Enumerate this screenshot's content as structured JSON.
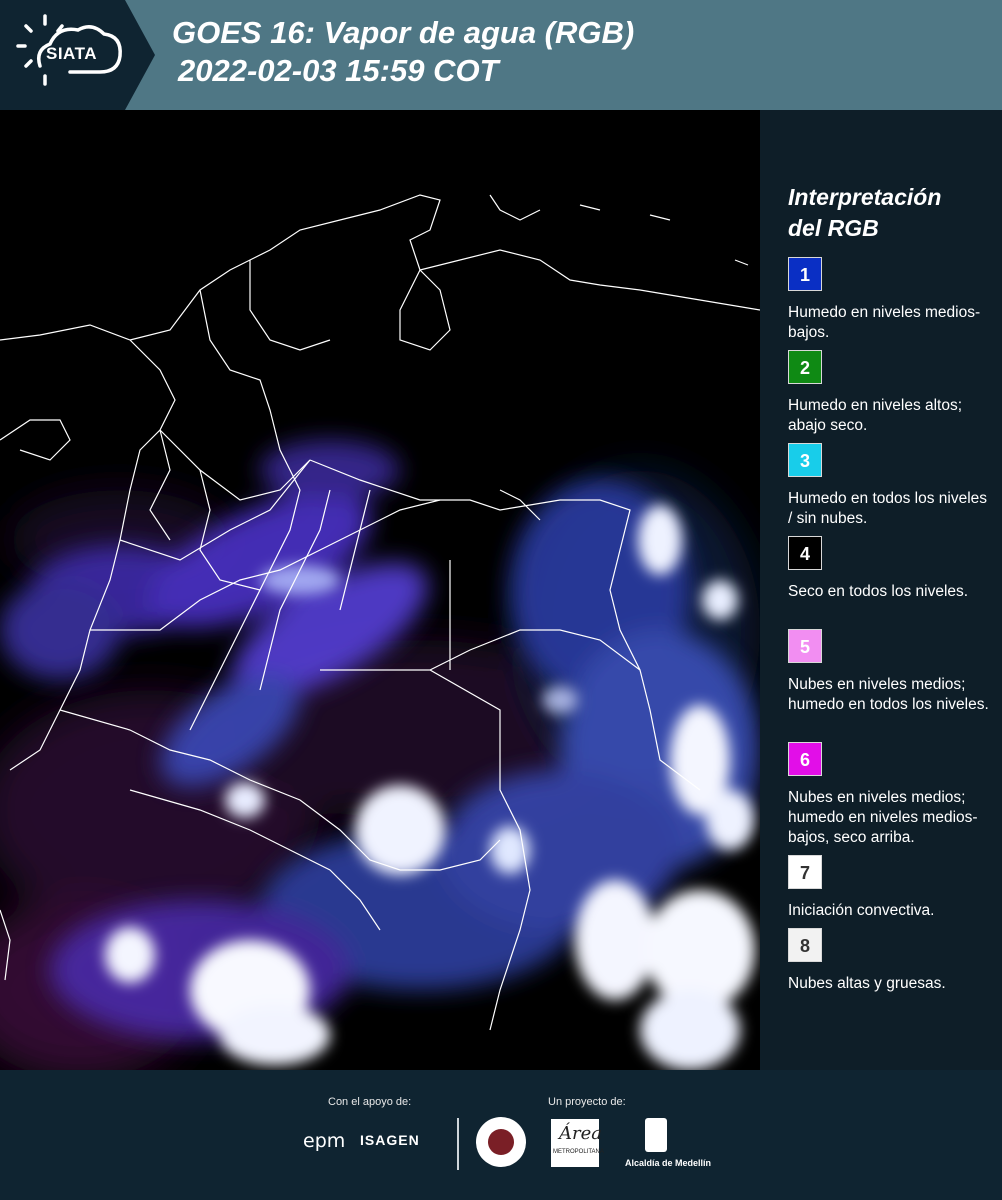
{
  "header": {
    "logo_text": "SIATA",
    "title_line1": "GOES 16: Vapor de agua (RGB)",
    "title_line2": "2022-02-03 15:59 COT",
    "background": "#4f7785"
  },
  "legend": {
    "title_line1": "Interpretación",
    "title_line2": "del RGB",
    "items": [
      {
        "num": "1",
        "color": "#0a2fc4",
        "text_color": "#ffffff",
        "label": "Humedo en niveles medios-bajos."
      },
      {
        "num": "2",
        "color": "#0f8a14",
        "text_color": "#ffffff",
        "label": "Humedo en niveles altos; abajo seco."
      },
      {
        "num": "3",
        "color": "#18cdea",
        "text_color": "#ffffff",
        "label": "Humedo en todos los niveles / sin nubes."
      },
      {
        "num": "4",
        "color": "#000000",
        "text_color": "#ffffff",
        "label": "Seco en todos los niveles."
      },
      {
        "num": "5",
        "color": "#f28ef2",
        "text_color": "#ffffff",
        "label": "Nubes en niveles medios; humedo en todos los niveles."
      },
      {
        "num": "6",
        "color": "#e20ee8",
        "text_color": "#ffffff",
        "label": "Nubes en niveles medios; humedo en niveles medios-bajos, seco arriba."
      },
      {
        "num": "7",
        "color": "#ffffff",
        "text_color": "#333333",
        "label": "Iniciación convectiva."
      },
      {
        "num": "8",
        "color": "#f2f2f2",
        "text_color": "#333333",
        "label": "Nubes altas y gruesas."
      }
    ]
  },
  "footer": {
    "support_label": "Con el apoyo de:",
    "project_label": "Un proyecto de:",
    "epm": "epm",
    "isagen": "ISAGEN",
    "area_logo": "Área",
    "area_sub": "METROPOLITANA",
    "alcaldia": "Alcaldía de Medellín"
  }
}
